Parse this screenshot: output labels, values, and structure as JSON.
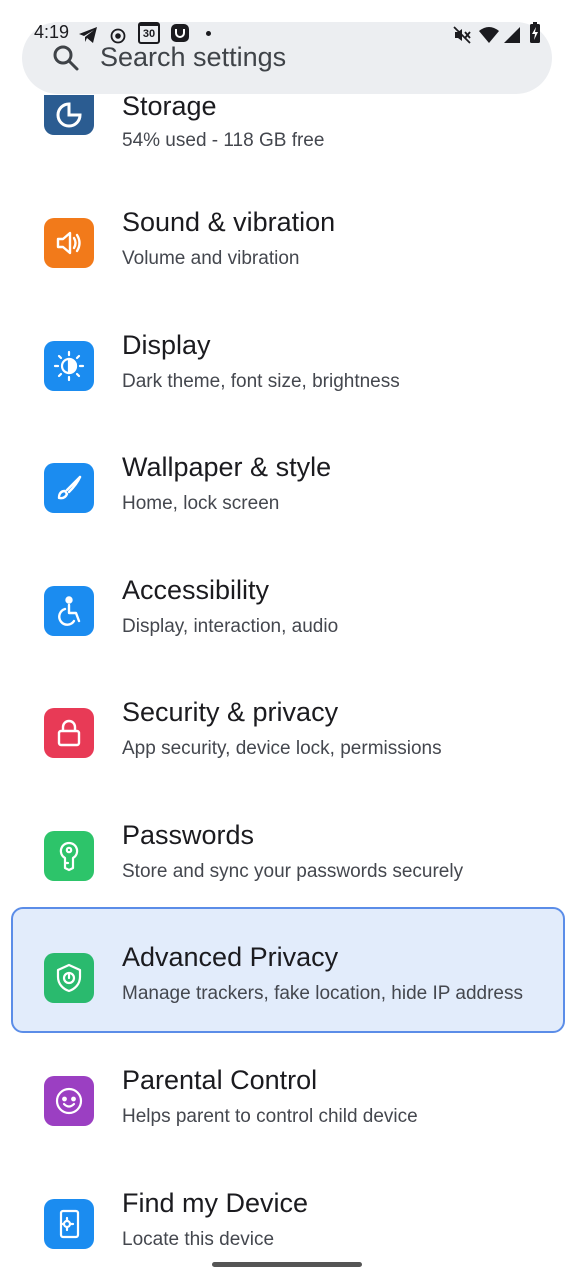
{
  "status_bar": {
    "time": "4:19",
    "calendar_day": "30",
    "icons": [
      "telegram-icon",
      "record-icon",
      "calendar-icon",
      "app-icon",
      "dot-icon",
      "mute-icon",
      "wifi-icon",
      "signal-icon",
      "battery-icon"
    ]
  },
  "search": {
    "placeholder": "Search settings"
  },
  "items": [
    {
      "title": "Storage",
      "subtitle": "54% used - 118 GB free",
      "icon": "storage-icon",
      "color": "#2b5c91"
    },
    {
      "title": "Sound & vibration",
      "subtitle": "Volume and vibration",
      "icon": "speaker-icon",
      "color": "#f27a1a"
    },
    {
      "title": "Display",
      "subtitle": "Dark theme, font size, brightness",
      "icon": "brightness-icon",
      "color": "#1b8cf0"
    },
    {
      "title": "Wallpaper & style",
      "subtitle": "Home, lock screen",
      "icon": "brush-icon",
      "color": "#1b8cf0"
    },
    {
      "title": "Accessibility",
      "subtitle": "Display, interaction, audio",
      "icon": "accessibility-icon",
      "color": "#1b8cf0"
    },
    {
      "title": "Security & privacy",
      "subtitle": "App security, device lock, permissions",
      "icon": "lock-icon",
      "color": "#e83a56"
    },
    {
      "title": "Passwords",
      "subtitle": "Store and sync your passwords securely",
      "icon": "key-icon",
      "color": "#2dc46a"
    },
    {
      "title": "Advanced Privacy",
      "subtitle": "Manage trackers, fake location, hide IP address",
      "icon": "shield-icon",
      "color": "#2aba6e"
    },
    {
      "title": "Parental Control",
      "subtitle": "Helps parent to control child device",
      "icon": "child-face-icon",
      "color": "#9b3fc2"
    },
    {
      "title": "Find my Device",
      "subtitle": "Locate this device",
      "icon": "find-device-icon",
      "color": "#1b8cf0"
    }
  ]
}
